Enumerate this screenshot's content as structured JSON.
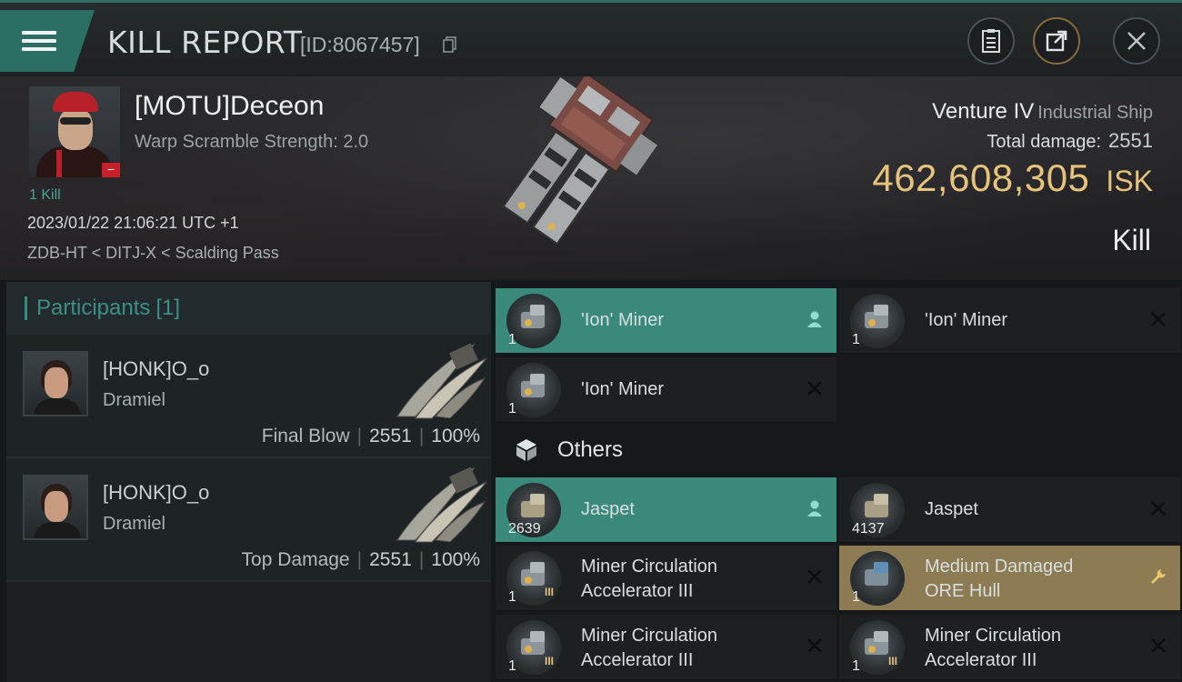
{
  "header": {
    "title": "KILL REPORT",
    "report_id": "[ID:8067457]"
  },
  "victim": {
    "name": "[MOTU]Deceon",
    "scramble": "Warp Scramble Strength: 2.0",
    "kills": "1 Kill",
    "datetime": "2023/01/22 21:06:21 UTC +1",
    "location": "ZDB-HT < DITJ-X < Scalding Pass",
    "badge": "−"
  },
  "ship": {
    "name": "Venture IV",
    "type": "Industrial Ship",
    "total_damage_label": "Total damage:",
    "total_damage": "2551",
    "isk_value": "462,608,305",
    "isk_unit": "ISK",
    "result": "Kill"
  },
  "participants": {
    "label": "Participants",
    "count": "[1]",
    "rows": [
      {
        "name": "[HONK]O_o",
        "ship": "Dramiel",
        "stat_label": "Final Blow",
        "damage": "2551",
        "percent": "100%"
      },
      {
        "name": "[HONK]O_o",
        "ship": "Dramiel",
        "stat_label": "Top Damage",
        "damage": "2551",
        "percent": "100%"
      }
    ]
  },
  "items": {
    "top": [
      {
        "name": "'Ion' Miner",
        "qty": "1",
        "state": "owner"
      },
      {
        "name": "'Ion' Miner",
        "qty": "1",
        "state": "destroyed"
      },
      {
        "name": "'Ion' Miner",
        "qty": "1",
        "state": "destroyed"
      }
    ],
    "others_label": "Others",
    "others": [
      {
        "name": "Jaspet",
        "qty": "2639",
        "state": "owner"
      },
      {
        "name": "Jaspet",
        "qty": "4137",
        "state": "destroyed"
      },
      {
        "name_line1": "Miner Circulation",
        "name_line2": "Accelerator III",
        "qty": "1",
        "state": "destroyed"
      },
      {
        "name_line1": "Medium Damaged",
        "name_line2": "ORE Hull",
        "qty": "1",
        "state": "repair"
      },
      {
        "name_line1": "Miner Circulation",
        "name_line2": "Accelerator III",
        "qty": "1",
        "state": "destroyed"
      },
      {
        "name_line1": "Miner Circulation",
        "name_line2": "Accelerator III",
        "qty": "1",
        "state": "destroyed"
      }
    ]
  },
  "colors": {
    "accent": "#3a8a7c",
    "isk": "#e6c27a",
    "repair": "#8c7b53"
  },
  "icons": [
    "menu-icon",
    "copy-icon",
    "clipboard-icon",
    "share-icon",
    "close-icon",
    "person-icon",
    "x-icon",
    "wrench-icon",
    "cube-icon"
  ]
}
